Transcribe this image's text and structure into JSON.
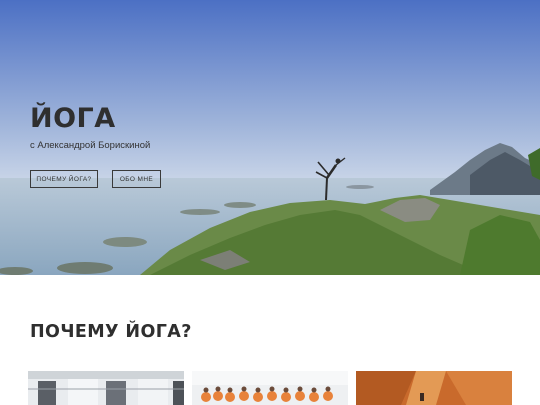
{
  "hero": {
    "title": "ЙОГА",
    "subtitle": "с Александрой Борискиной",
    "buttons": [
      {
        "label": "ПОЧЕМУ ЙОГА?"
      },
      {
        "label": "ОБО МНЕ"
      }
    ]
  },
  "why": {
    "heading": "ПОЧЕМУ ЙОГА?"
  },
  "colors": {
    "sky_top": "#4f74c6",
    "sky_bottom": "#dfe6ef",
    "sea": "#9bb3c8",
    "grass": "#5a8a3a",
    "text_dark": "#2f2f2f"
  }
}
